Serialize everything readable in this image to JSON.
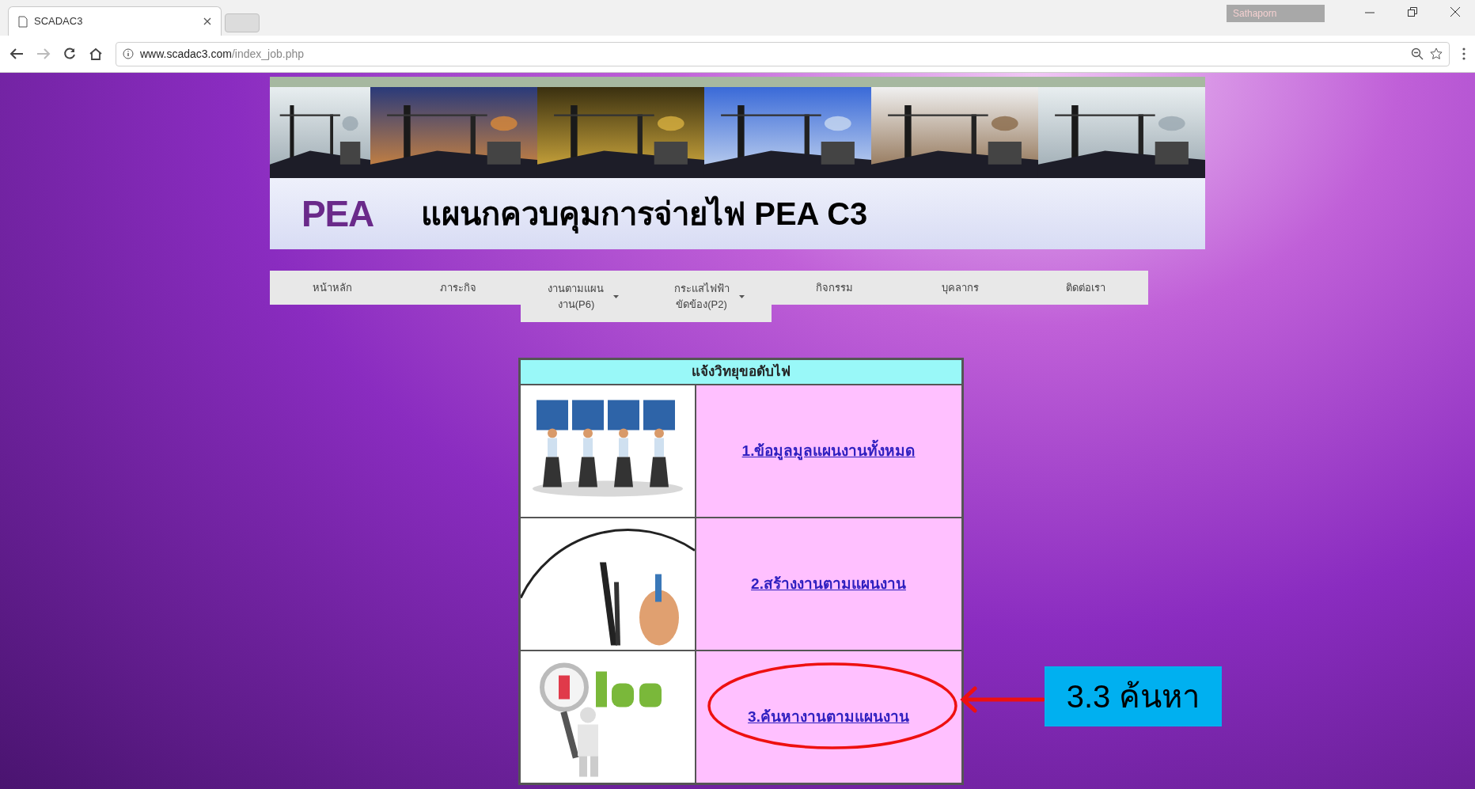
{
  "browser": {
    "tab_title": "SCADAC3",
    "profile": "Sathaporn",
    "url_host": "www.scadac3.com",
    "url_path": "/index_job.php"
  },
  "banner": {
    "logo": "PEA",
    "title": "แผนกควบคุมการจ่ายไฟ PEA C3"
  },
  "nav": [
    {
      "kind": "link",
      "lines": [
        "หน้าหลัก"
      ]
    },
    {
      "kind": "link",
      "lines": [
        "ภาระกิจ"
      ]
    },
    {
      "kind": "dropdown",
      "lines": [
        "งานตามแผน",
        "งาน(P6)"
      ]
    },
    {
      "kind": "dropdown",
      "lines": [
        "กระแสไฟฟ้า",
        "ขัดข้อง(P2)"
      ]
    },
    {
      "kind": "link",
      "lines": [
        "กิจกรรม"
      ]
    },
    {
      "kind": "link",
      "lines": [
        "บุคลากร"
      ]
    },
    {
      "kind": "link",
      "lines": [
        "ติดต่อเรา"
      ]
    }
  ],
  "table": {
    "header": "แจ้งวิทยุขอดับไฟ",
    "rows": [
      {
        "kind": "people",
        "link": "1.ข้อมูลมูลแผนงานทั้งหมด",
        "circled": false
      },
      {
        "kind": "clock",
        "link": "2.สร้างงานตามแผนงาน",
        "circled": false
      },
      {
        "kind": "magnifier",
        "link": "3.ค้นหางานตามแผนงาน",
        "circled": true
      }
    ]
  },
  "callout": {
    "text": "3.3 ค้นหา"
  }
}
